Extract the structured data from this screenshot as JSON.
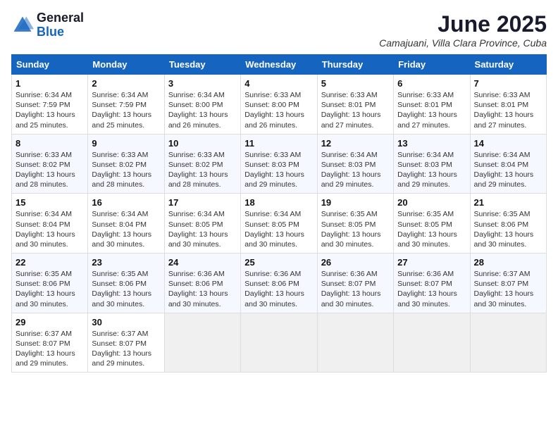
{
  "header": {
    "logo_general": "General",
    "logo_blue": "Blue",
    "title": "June 2025",
    "location": "Camajuani, Villa Clara Province, Cuba"
  },
  "weekdays": [
    "Sunday",
    "Monday",
    "Tuesday",
    "Wednesday",
    "Thursday",
    "Friday",
    "Saturday"
  ],
  "weeks": [
    [
      {
        "day": "1",
        "sunrise": "6:34 AM",
        "sunset": "7:59 PM",
        "daylight": "13 hours and 25 minutes."
      },
      {
        "day": "2",
        "sunrise": "6:34 AM",
        "sunset": "7:59 PM",
        "daylight": "13 hours and 25 minutes."
      },
      {
        "day": "3",
        "sunrise": "6:34 AM",
        "sunset": "8:00 PM",
        "daylight": "13 hours and 26 minutes."
      },
      {
        "day": "4",
        "sunrise": "6:33 AM",
        "sunset": "8:00 PM",
        "daylight": "13 hours and 26 minutes."
      },
      {
        "day": "5",
        "sunrise": "6:33 AM",
        "sunset": "8:01 PM",
        "daylight": "13 hours and 27 minutes."
      },
      {
        "day": "6",
        "sunrise": "6:33 AM",
        "sunset": "8:01 PM",
        "daylight": "13 hours and 27 minutes."
      },
      {
        "day": "7",
        "sunrise": "6:33 AM",
        "sunset": "8:01 PM",
        "daylight": "13 hours and 27 minutes."
      }
    ],
    [
      {
        "day": "8",
        "sunrise": "6:33 AM",
        "sunset": "8:02 PM",
        "daylight": "13 hours and 28 minutes."
      },
      {
        "day": "9",
        "sunrise": "6:33 AM",
        "sunset": "8:02 PM",
        "daylight": "13 hours and 28 minutes."
      },
      {
        "day": "10",
        "sunrise": "6:33 AM",
        "sunset": "8:02 PM",
        "daylight": "13 hours and 28 minutes."
      },
      {
        "day": "11",
        "sunrise": "6:33 AM",
        "sunset": "8:03 PM",
        "daylight": "13 hours and 29 minutes."
      },
      {
        "day": "12",
        "sunrise": "6:34 AM",
        "sunset": "8:03 PM",
        "daylight": "13 hours and 29 minutes."
      },
      {
        "day": "13",
        "sunrise": "6:34 AM",
        "sunset": "8:03 PM",
        "daylight": "13 hours and 29 minutes."
      },
      {
        "day": "14",
        "sunrise": "6:34 AM",
        "sunset": "8:04 PM",
        "daylight": "13 hours and 29 minutes."
      }
    ],
    [
      {
        "day": "15",
        "sunrise": "6:34 AM",
        "sunset": "8:04 PM",
        "daylight": "13 hours and 30 minutes."
      },
      {
        "day": "16",
        "sunrise": "6:34 AM",
        "sunset": "8:04 PM",
        "daylight": "13 hours and 30 minutes."
      },
      {
        "day": "17",
        "sunrise": "6:34 AM",
        "sunset": "8:05 PM",
        "daylight": "13 hours and 30 minutes."
      },
      {
        "day": "18",
        "sunrise": "6:34 AM",
        "sunset": "8:05 PM",
        "daylight": "13 hours and 30 minutes."
      },
      {
        "day": "19",
        "sunrise": "6:35 AM",
        "sunset": "8:05 PM",
        "daylight": "13 hours and 30 minutes."
      },
      {
        "day": "20",
        "sunrise": "6:35 AM",
        "sunset": "8:05 PM",
        "daylight": "13 hours and 30 minutes."
      },
      {
        "day": "21",
        "sunrise": "6:35 AM",
        "sunset": "8:06 PM",
        "daylight": "13 hours and 30 minutes."
      }
    ],
    [
      {
        "day": "22",
        "sunrise": "6:35 AM",
        "sunset": "8:06 PM",
        "daylight": "13 hours and 30 minutes."
      },
      {
        "day": "23",
        "sunrise": "6:35 AM",
        "sunset": "8:06 PM",
        "daylight": "13 hours and 30 minutes."
      },
      {
        "day": "24",
        "sunrise": "6:36 AM",
        "sunset": "8:06 PM",
        "daylight": "13 hours and 30 minutes."
      },
      {
        "day": "25",
        "sunrise": "6:36 AM",
        "sunset": "8:06 PM",
        "daylight": "13 hours and 30 minutes."
      },
      {
        "day": "26",
        "sunrise": "6:36 AM",
        "sunset": "8:07 PM",
        "daylight": "13 hours and 30 minutes."
      },
      {
        "day": "27",
        "sunrise": "6:36 AM",
        "sunset": "8:07 PM",
        "daylight": "13 hours and 30 minutes."
      },
      {
        "day": "28",
        "sunrise": "6:37 AM",
        "sunset": "8:07 PM",
        "daylight": "13 hours and 30 minutes."
      }
    ],
    [
      {
        "day": "29",
        "sunrise": "6:37 AM",
        "sunset": "8:07 PM",
        "daylight": "13 hours and 29 minutes."
      },
      {
        "day": "30",
        "sunrise": "6:37 AM",
        "sunset": "8:07 PM",
        "daylight": "13 hours and 29 minutes."
      },
      null,
      null,
      null,
      null,
      null
    ]
  ]
}
